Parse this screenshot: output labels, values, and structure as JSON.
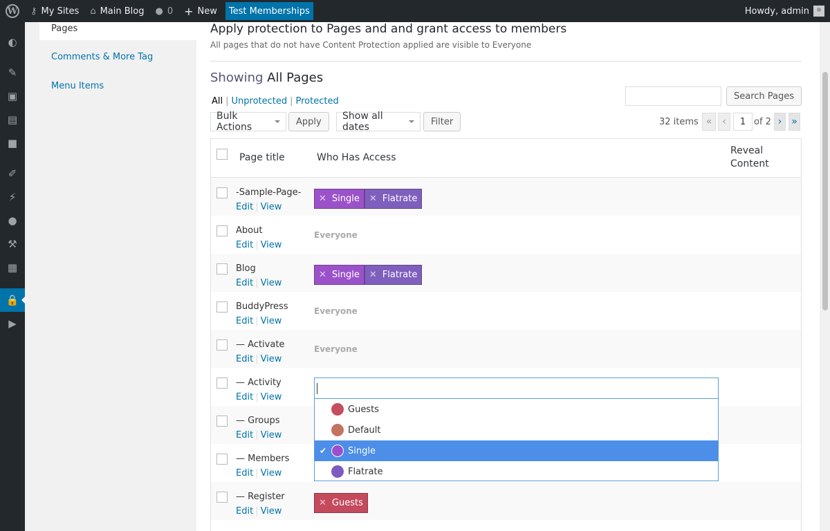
{
  "adminbar": {
    "my_sites": "My Sites",
    "main_blog": "Main Blog",
    "comments_count": "0",
    "new": "New",
    "test_memberships": "Test Memberships",
    "howdy": "Howdy, admin"
  },
  "subnav": {
    "active": "Pages",
    "items": [
      "Comments & More Tag",
      "Menu Items"
    ]
  },
  "header": {
    "title": "Apply protection to Pages and and grant access to members",
    "description": "All pages that do not have Content Protection applied are visible to Everyone"
  },
  "showing": {
    "prefix": "Showing",
    "value": "All Pages"
  },
  "filters": {
    "all": "All",
    "unprotected": "Unprotected",
    "protected": "Protected"
  },
  "controls": {
    "bulk_actions": "Bulk Actions",
    "apply": "Apply",
    "dates": "Show all dates",
    "filter": "Filter",
    "search_button": "Search Pages",
    "search_value": ""
  },
  "pagination": {
    "items": "32 items",
    "first": "«",
    "prev": "‹",
    "current": "1",
    "of": "of 2",
    "next": "›",
    "last": "»"
  },
  "table": {
    "col_title": "Page title",
    "col_access": "Who Has Access",
    "col_reveal_1": "Reveal",
    "col_reveal_2": "Content",
    "edit": "Edit",
    "view": "View",
    "rows": [
      {
        "title": "-Sample-Page-",
        "tags": [
          "Single",
          "Flatrate"
        ]
      },
      {
        "title": "About",
        "everyone": "Everyone"
      },
      {
        "title": "Blog",
        "tags": [
          "Single",
          "Flatrate"
        ]
      },
      {
        "title": "BuddyPress",
        "everyone": "Everyone"
      },
      {
        "title": "— Activate",
        "everyone": "Everyone"
      },
      {
        "title": "— Activity"
      },
      {
        "title": "— Groups"
      },
      {
        "title": "— Members"
      },
      {
        "title": "— Register",
        "tags": [
          "Guests"
        ]
      }
    ]
  },
  "dropdown": {
    "options": [
      {
        "label": "Guests",
        "color": "#c64d60"
      },
      {
        "label": "Default",
        "color": "#c27461"
      },
      {
        "label": "Single",
        "color": "#9b4fce",
        "selected": true
      },
      {
        "label": "Flatrate",
        "color": "#7e5bc0"
      }
    ]
  },
  "colors": {
    "single": "#9b52c9",
    "flatrate": "#7f5fbd",
    "guests": "#c44a5d",
    "accent": "#0073aa"
  }
}
